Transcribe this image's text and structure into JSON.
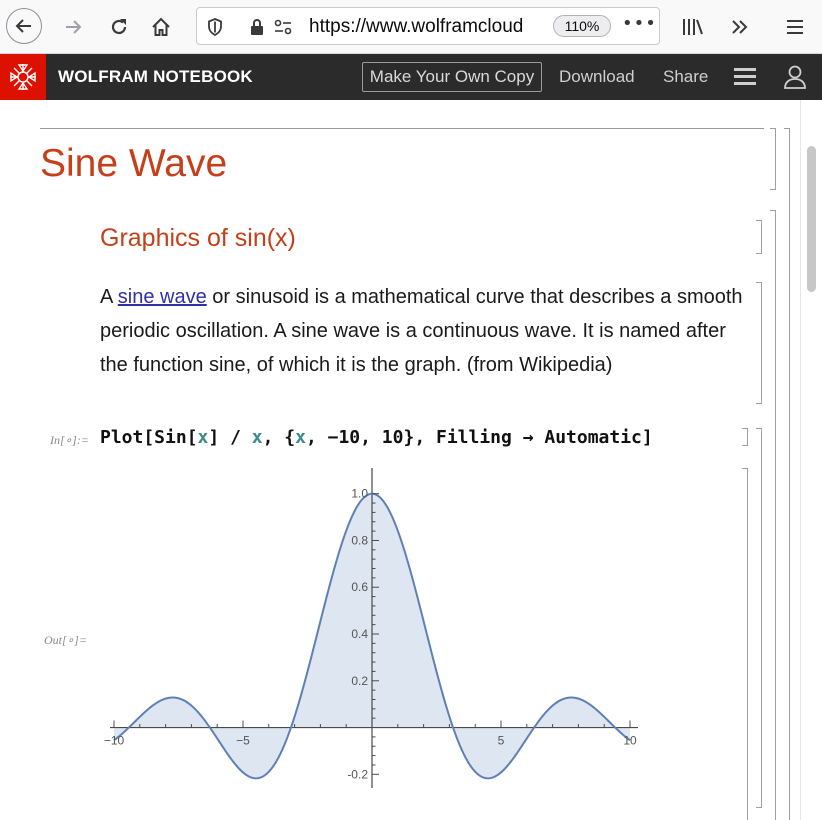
{
  "browser": {
    "url_prefix": "https://www.",
    "url_host": "wolframcloud",
    "zoom": "110%",
    "more_icon": "•••"
  },
  "header": {
    "title": "WOLFRAM NOTEBOOK",
    "copy_button": "Make Your Own Copy",
    "download": "Download",
    "share": "Share"
  },
  "notebook": {
    "title": "Sine Wave",
    "section": "Graphics of sin(x)",
    "paragraph": {
      "prefix": "A ",
      "link": "sine wave",
      "rest": " or sinusoid is a mathematical curve that describes a smooth periodic oscillation. A sine wave is a continuous wave. It is named after the function sine, of which it is the graph. (from Wikipedia)"
    },
    "input_label": "In[∘]:=",
    "output_label": "Out[∘]=",
    "code": {
      "p1": "Plot[Sin[",
      "v1": "x",
      "p2": "] / ",
      "v2": "x",
      "p3": ", {",
      "v3": "x",
      "p4": ", −10, 10}, Filling → Automatic]"
    }
  },
  "chart_data": {
    "type": "area",
    "function": "Sin[x]/x",
    "xlim": [
      -10,
      10
    ],
    "ylim": [
      -0.25,
      1.05
    ],
    "x_ticks": [
      -10,
      -5,
      5,
      10
    ],
    "x_tick_labels": [
      "−10",
      "−5",
      "5",
      "10"
    ],
    "y_ticks": [
      -0.2,
      0.2,
      0.4,
      0.6,
      0.8,
      1.0
    ],
    "y_tick_labels": [
      "-0.2",
      "0.2",
      "0.4",
      "0.6",
      "0.8",
      "1.0"
    ],
    "filling": "axis",
    "line_color": "#5e81b5",
    "fill_color": "#d9e3f0"
  }
}
